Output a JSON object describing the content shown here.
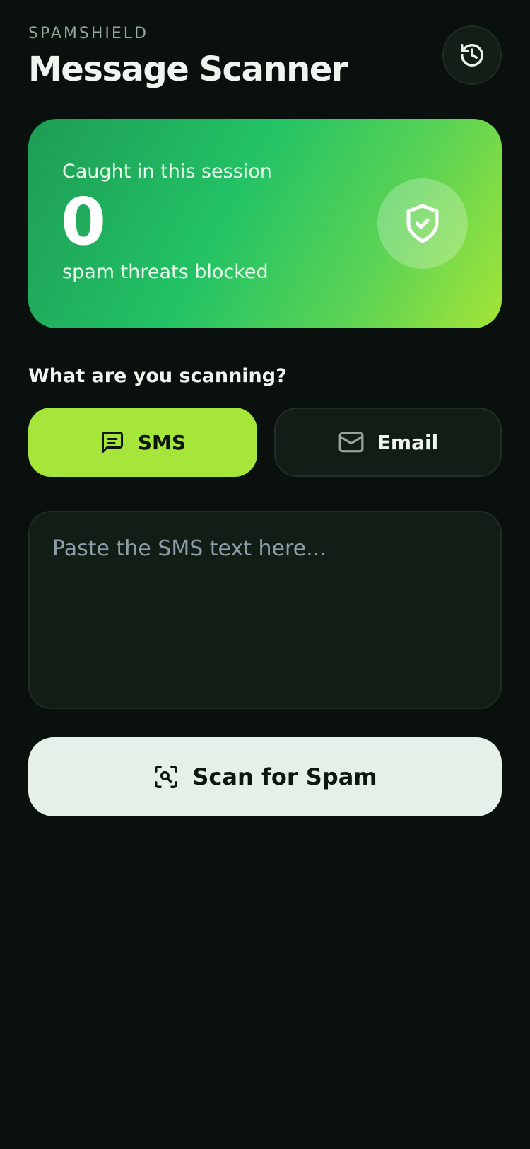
{
  "header": {
    "brand": "SPAMSHIELD",
    "title": "Message Scanner",
    "history_icon": "history-icon"
  },
  "stats": {
    "label": "Caught in this session",
    "count": "0",
    "sublabel": "spam threats blocked",
    "icon": "shield-check-icon"
  },
  "scan_type": {
    "label": "What are you scanning?",
    "options": [
      {
        "label": "SMS",
        "icon": "message-square-icon",
        "selected": true
      },
      {
        "label": "Email",
        "icon": "mail-icon",
        "selected": false
      }
    ]
  },
  "input": {
    "value": "",
    "placeholder": "Paste the SMS text here..."
  },
  "scan_button": {
    "label": "Scan for Spam",
    "icon": "scan-search-icon"
  },
  "colors": {
    "background": "#0a100d",
    "accent": "#a6e63a",
    "card_gradient_start": "#1e9c56",
    "card_gradient_end": "#a4e436",
    "button_bg": "#e6f0e8"
  }
}
